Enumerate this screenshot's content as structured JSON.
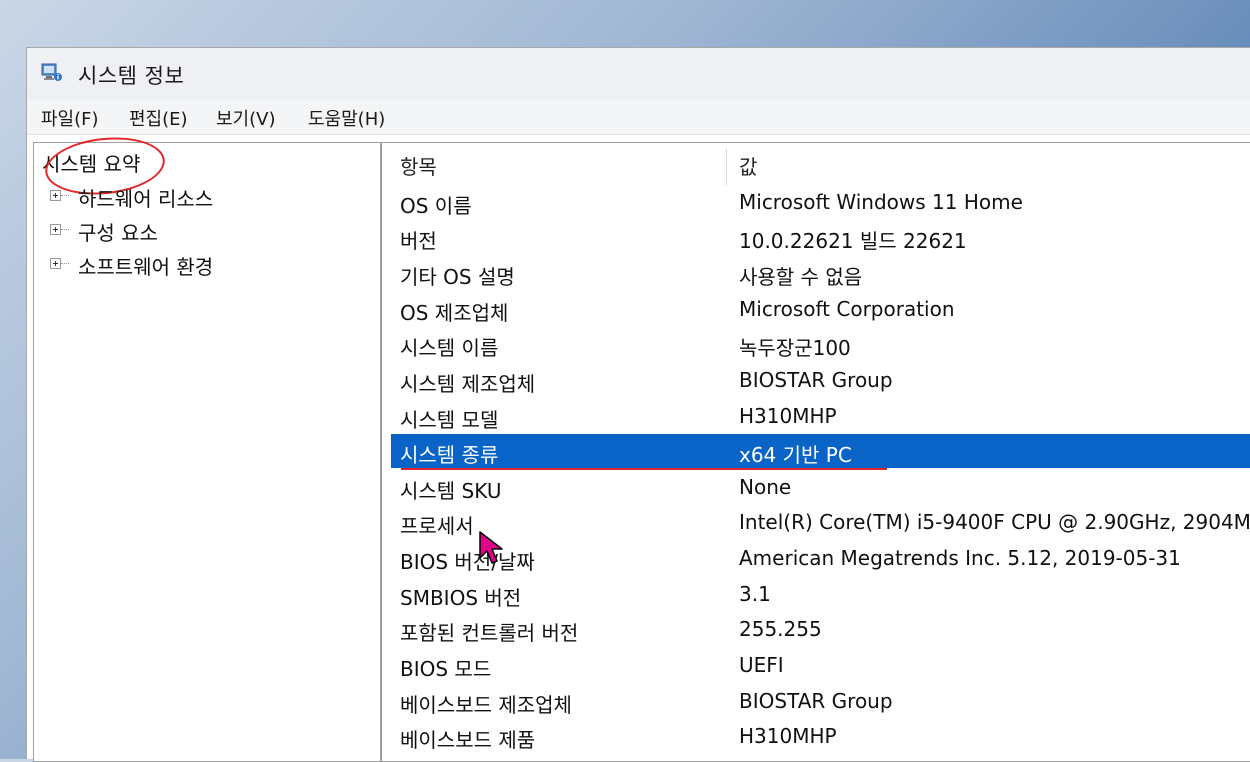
{
  "window": {
    "title": "시스템 정보"
  },
  "menu": [
    "파일(F)",
    "편집(E)",
    "보기(V)",
    "도움말(H)"
  ],
  "tree": {
    "root": "시스템 요약",
    "children": [
      "하드웨어 리소스",
      "구성 요소",
      "소프트웨어 환경"
    ]
  },
  "table": {
    "headers": [
      "항목",
      "값"
    ],
    "rows": [
      {
        "k": "OS 이름",
        "v": "Microsoft Windows 11 Home"
      },
      {
        "k": "버전",
        "v": "10.0.22621 빌드 22621"
      },
      {
        "k": "기타 OS 설명",
        "v": "사용할 수 없음"
      },
      {
        "k": "OS 제조업체",
        "v": "Microsoft Corporation"
      },
      {
        "k": "시스템 이름",
        "v": "녹두장군100"
      },
      {
        "k": "시스템 제조업체",
        "v": "BIOSTAR Group"
      },
      {
        "k": "시스템 모델",
        "v": "H310MHP"
      },
      {
        "k": "시스템 종류",
        "v": "x64 기반 PC"
      },
      {
        "k": "시스템 SKU",
        "v": "None"
      },
      {
        "k": "프로세서",
        "v": "Intel(R) Core(TM) i5-9400F CPU @ 2.90GHz, 2904M"
      },
      {
        "k": "BIOS 버전/날짜",
        "v": "American Megatrends Inc. 5.12, 2019-05-31"
      },
      {
        "k": "SMBIOS 버전",
        "v": "3.1"
      },
      {
        "k": "포함된 컨트롤러 버전",
        "v": "255.255"
      },
      {
        "k": "BIOS 모드",
        "v": "UEFI"
      },
      {
        "k": "베이스보드 제조업체",
        "v": "BIOSTAR Group"
      },
      {
        "k": "베이스보드 제품",
        "v": "H310MHP"
      }
    ],
    "selected_index": 7
  },
  "colors": {
    "selection": "#0a64c8",
    "annotation": "#e3262b",
    "cursor": "#e0008a"
  },
  "icons": [
    "system-info-app-icon",
    "expander-plus-icon",
    "mouse-cursor-icon"
  ]
}
